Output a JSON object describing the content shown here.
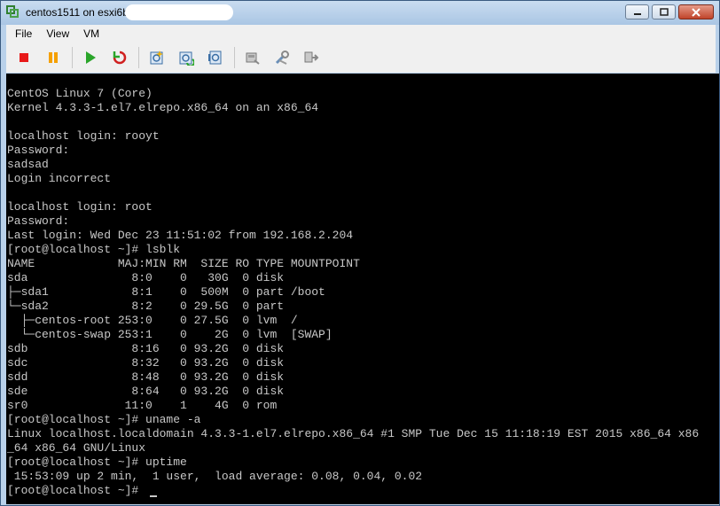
{
  "window": {
    "title": "centos1511 on esxi6b",
    "controls": {
      "minimize": "minimize-icon",
      "maximize": "maximize-icon",
      "close": "close-icon"
    }
  },
  "menu": {
    "items": [
      {
        "label": "File"
      },
      {
        "label": "View"
      },
      {
        "label": "VM"
      }
    ]
  },
  "toolbar": {
    "buttons": [
      {
        "name": "power-off",
        "icon": "stop-icon",
        "color": "#e81a1a"
      },
      {
        "name": "suspend",
        "icon": "pause-icon",
        "color": "#f5a000"
      },
      {
        "name": "power-on",
        "icon": "play-icon",
        "color": "#2aa52a"
      },
      {
        "name": "reset",
        "icon": "reset-icon",
        "color": "#d02020"
      },
      {
        "name": "snapshot",
        "icon": "snapshot-icon"
      },
      {
        "name": "revert-snapshot",
        "icon": "revert-snapshot-icon"
      },
      {
        "name": "manage-snapshots",
        "icon": "manage-snapshots-icon"
      },
      {
        "name": "devices",
        "icon": "devices-icon"
      },
      {
        "name": "settings",
        "icon": "settings-icon"
      },
      {
        "name": "connect",
        "icon": "connect-icon"
      }
    ]
  },
  "console": {
    "lines": [
      "CentOS Linux 7 (Core)",
      "Kernel 4.3.3-1.el7.elrepo.x86_64 on an x86_64",
      "",
      "localhost login: rooyt",
      "Password:",
      "sadsad",
      "Login incorrect",
      "",
      "localhost login: root",
      "Password:",
      "Last login: Wed Dec 23 11:51:02 from 192.168.2.204",
      "[root@localhost ~]# lsblk",
      "NAME            MAJ:MIN RM  SIZE RO TYPE MOUNTPOINT",
      "sda               8:0    0   30G  0 disk",
      "├─sda1            8:1    0  500M  0 part /boot",
      "└─sda2            8:2    0 29.5G  0 part",
      "  ├─centos-root 253:0    0 27.5G  0 lvm  /",
      "  └─centos-swap 253:1    0    2G  0 lvm  [SWAP]",
      "sdb               8:16   0 93.2G  0 disk",
      "sdc               8:32   0 93.2G  0 disk",
      "sdd               8:48   0 93.2G  0 disk",
      "sde               8:64   0 93.2G  0 disk",
      "sr0              11:0    1    4G  0 rom",
      "[root@localhost ~]# uname -a",
      "Linux localhost.localdomain 4.3.3-1.el7.elrepo.x86_64 #1 SMP Tue Dec 15 11:18:19 EST 2015 x86_64 x86",
      "_64 x86_64 GNU/Linux",
      "[root@localhost ~]# uptime",
      " 15:53:09 up 2 min,  1 user,  load average: 0.08, 0.04, 0.02",
      "[root@localhost ~]# "
    ]
  }
}
